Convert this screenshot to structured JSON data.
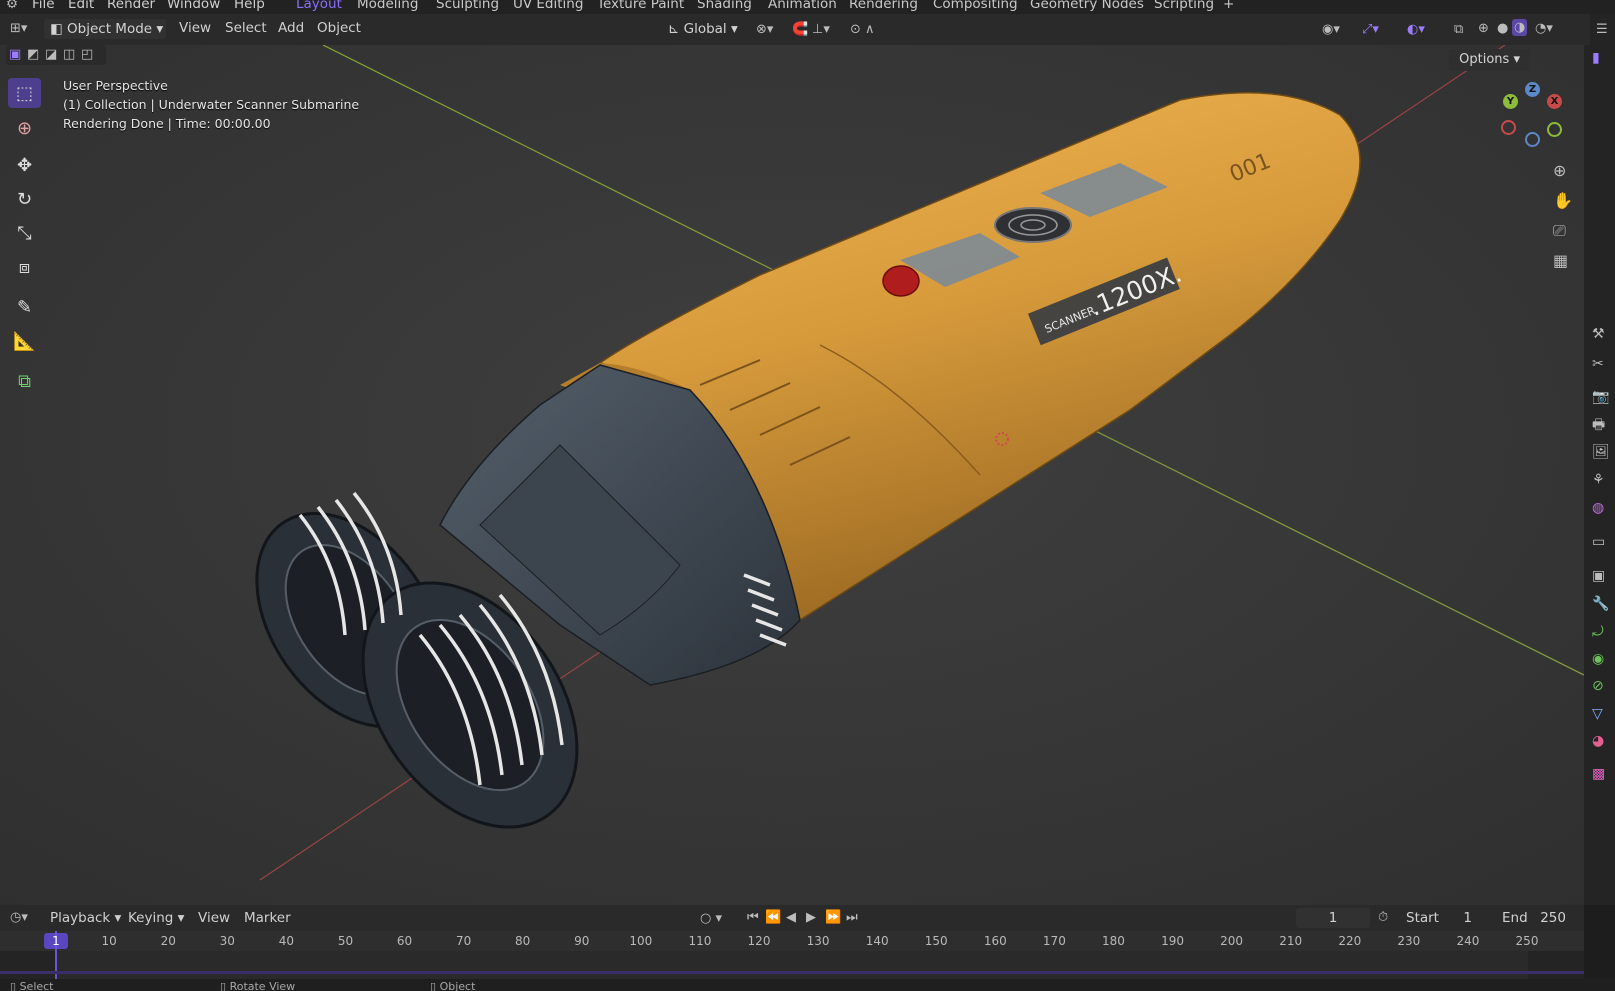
{
  "menubar": {
    "items": [
      "File",
      "Edit",
      "Render",
      "Window",
      "Help"
    ],
    "workspaces": [
      "Layout",
      "Modeling",
      "Sculpting",
      "UV Editing",
      "Texture Paint",
      "Shading",
      "Animation",
      "Rendering",
      "Compositing",
      "Geometry Nodes",
      "Scripting"
    ],
    "active_workspace": "Layout",
    "add_workspace": "+"
  },
  "header": {
    "mode": "Object Mode",
    "menus": [
      "View",
      "Select",
      "Add",
      "Object"
    ],
    "orientation": "Global",
    "options": "Options"
  },
  "viewport": {
    "overlay_lines": [
      "User Perspective",
      "(1) Collection | Underwater Scanner Submarine",
      "Rendering Done | Time: 00:00.00"
    ],
    "decal_text_small": "SCANNER",
    "decal_text_large": ".1200X.",
    "hull_number": "001",
    "gizmo": {
      "x": "X",
      "y": "Y",
      "z": "Z"
    }
  },
  "timeline": {
    "menus": [
      "Playback",
      "Keying",
      "View",
      "Marker"
    ],
    "current_frame": "1",
    "start_label": "Start",
    "start_value": "1",
    "end_label": "End",
    "end_value": "250",
    "ruler": [
      "1",
      "10",
      "20",
      "30",
      "40",
      "50",
      "60",
      "70",
      "80",
      "90",
      "100",
      "110",
      "120",
      "130",
      "140",
      "150",
      "160",
      "170",
      "180",
      "190",
      "200",
      "210",
      "220",
      "230",
      "240",
      "250"
    ]
  },
  "status": {
    "items": [
      "Select",
      "Rotate View",
      "Object"
    ]
  },
  "colors": {
    "accent": "#8a6cff",
    "hull": "#d79a3a",
    "thruster": "#3f4854",
    "axis_x": "#c64a4a",
    "axis_y": "#8dbb3c",
    "axis_z": "#5b88c9"
  }
}
